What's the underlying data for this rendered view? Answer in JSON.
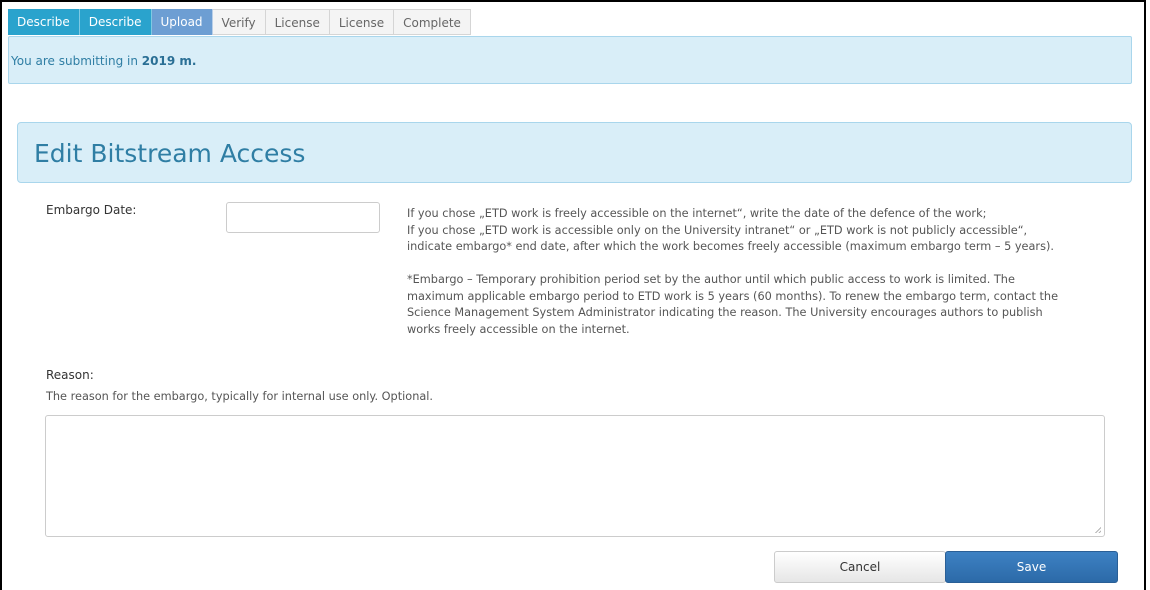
{
  "steps": [
    {
      "label": "Describe",
      "state": "done"
    },
    {
      "label": "Describe",
      "state": "done"
    },
    {
      "label": "Upload",
      "state": "current"
    },
    {
      "label": "Verify",
      "state": "todo"
    },
    {
      "label": "License",
      "state": "todo"
    },
    {
      "label": "License",
      "state": "todo"
    },
    {
      "label": "Complete",
      "state": "todo"
    }
  ],
  "banner": {
    "prefix": "You are submitting in ",
    "collection": "2019 m."
  },
  "heading": "Edit Bitstream Access",
  "embargo": {
    "label": "Embargo Date:",
    "value": "",
    "help_lines": [
      "If you chose „ETD work is freely accessible on the internet“, write the date of the defence of the work;",
      "If you chose „ETD work is accessible only on the University intranet“ or „ETD work is not publicly accessible“,",
      "indicate embargo* end date, after which the work becomes freely accessible (maximum embargo term – 5 years)."
    ],
    "note_lines": [
      "*Embargo – Temporary prohibition period set by the author until which public access to work is limited. The",
      "maximum applicable embargo period to ETD work is 5 years (60 months). To renew the embargo term, contact the",
      "Science Management System Administrator indicating the reason. The University encourages authors to publish",
      "works freely accessible on the internet."
    ]
  },
  "reason": {
    "label": "Reason:",
    "hint": "The reason for the embargo, typically for internal use only. Optional.",
    "value": ""
  },
  "buttons": {
    "cancel": "Cancel",
    "save": "Save"
  },
  "colors": {
    "done_tab": "#2aa3cd",
    "current_tab": "#6d9ed3",
    "banner_bg": "#d9eef8",
    "save_btn": "#3276b1"
  }
}
